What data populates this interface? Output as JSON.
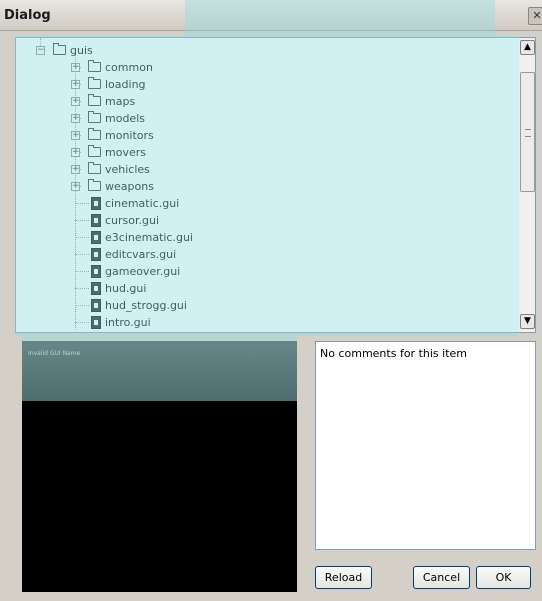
{
  "window": {
    "title": "Dialog",
    "close_glyph": "✕"
  },
  "tree": {
    "root": {
      "label": "guis",
      "expander": "−"
    },
    "folders": [
      {
        "label": "common"
      },
      {
        "label": "loading"
      },
      {
        "label": "maps"
      },
      {
        "label": "models"
      },
      {
        "label": "monitors"
      },
      {
        "label": "movers"
      },
      {
        "label": "vehicles"
      },
      {
        "label": "weapons"
      }
    ],
    "files": [
      {
        "label": "cinematic.gui"
      },
      {
        "label": "cursor.gui"
      },
      {
        "label": "e3cinematic.gui"
      },
      {
        "label": "editcvars.gui"
      },
      {
        "label": "gameover.gui"
      },
      {
        "label": "hud.gui"
      },
      {
        "label": "hud_strogg.gui"
      },
      {
        "label": "intro.gui"
      }
    ],
    "expand_glyph": "+"
  },
  "scrollbar": {
    "up_glyph": "▲",
    "down_glyph": "▼"
  },
  "preview": {
    "text": "Invalid GUI Name"
  },
  "comments": {
    "text": "No comments for this item"
  },
  "buttons": {
    "reload": "Reload",
    "cancel": "Cancel",
    "ok": "OK"
  },
  "colors": {
    "watermark": "#91dce1",
    "tree_border": "#7f9db9",
    "button_border": "#003c74"
  }
}
